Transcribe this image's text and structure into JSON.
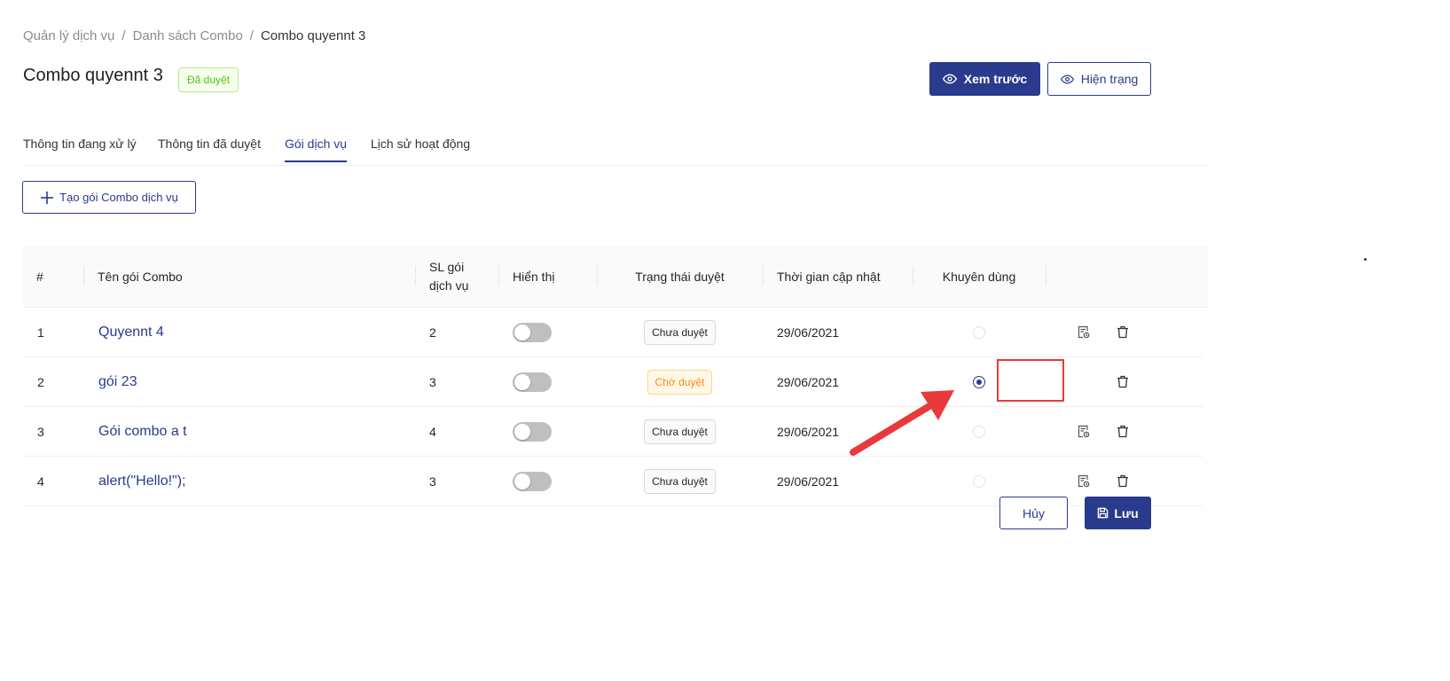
{
  "breadcrumb": {
    "items": [
      "Quản lý dịch vụ",
      "Danh sách Combo",
      "Combo quyennt 3"
    ],
    "separator": "/"
  },
  "header": {
    "title": "Combo quyennt 3",
    "status_tag": "Đã duyệt",
    "preview_button": "Xem trước",
    "current_status_button": "Hiện trạng"
  },
  "tabs": [
    {
      "label": "Thông tin đang xử lý",
      "active": false
    },
    {
      "label": "Thông tin đã duyệt",
      "active": false
    },
    {
      "label": "Gói dịch vụ",
      "active": true
    },
    {
      "label": "Lịch sử hoạt động",
      "active": false
    }
  ],
  "create_button": "Tạo gói Combo dịch vụ",
  "table": {
    "columns": {
      "index": "#",
      "name": "Tên gói Combo",
      "count_line1": "SL gói",
      "count_line2": "dịch vụ",
      "display": "Hiển thị",
      "approval": "Trạng thái duyệt",
      "updated": "Thời gian cập nhật",
      "recommended": "Khuyên dùng"
    },
    "rows": [
      {
        "index": "1",
        "name": "Quyennt 4",
        "count": "2",
        "display_on": false,
        "approval": "Chưa duyệt",
        "approval_style": "default",
        "updated": "29/06/2021",
        "recommended": false,
        "has_edit": true
      },
      {
        "index": "2",
        "name": "gói 23",
        "count": "3",
        "display_on": false,
        "approval": "Chờ duyệt",
        "approval_style": "warning",
        "updated": "29/06/2021",
        "recommended": true,
        "has_edit": false
      },
      {
        "index": "3",
        "name": "Gói combo a t",
        "count": "4",
        "display_on": false,
        "approval": "Chưa duyệt",
        "approval_style": "default",
        "updated": "29/06/2021",
        "recommended": false,
        "has_edit": true
      },
      {
        "index": "4",
        "name": "alert(\"Hello!\");",
        "count": "3",
        "display_on": false,
        "approval": "Chưa duyệt",
        "approval_style": "default",
        "updated": "29/06/2021",
        "recommended": false,
        "has_edit": true
      }
    ]
  },
  "footer": {
    "cancel_button": "Hủy",
    "save_button": "Lưu"
  },
  "icons": {
    "preview": "eye-icon",
    "status": "eye-icon",
    "create": "plus-icon",
    "edit": "edit-doc-icon",
    "delete": "trash-icon",
    "save": "save-icon"
  },
  "colors": {
    "primary": "#2a3a8c",
    "approved": "#52c41a",
    "pending": "#fa8c16",
    "annotation": "#e8393b"
  }
}
